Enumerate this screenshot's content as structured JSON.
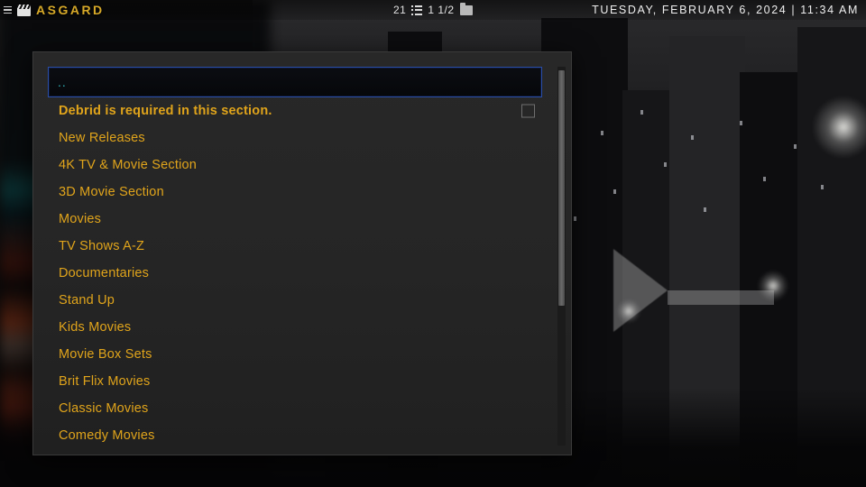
{
  "topbar": {
    "menu_icon": "hamburger-icon",
    "app_icon": "clapperboard-icon",
    "app_name": "ASGARD",
    "item_count": "21",
    "list_icon": "list-view-icon",
    "page_indicator": "1 1/2",
    "folder_icon": "folder-icon",
    "datetime": "TUESDAY, FEBRUARY 6, 2024 | 11:34 AM"
  },
  "dialog": {
    "checkbox_checked": false,
    "items": [
      {
        "label": "..",
        "selected": true,
        "bold": false,
        "checkbox": false
      },
      {
        "label": "Debrid is required in this section.",
        "selected": false,
        "bold": true,
        "checkbox": true
      },
      {
        "label": "New Releases",
        "selected": false,
        "bold": false,
        "checkbox": false
      },
      {
        "label": "4K TV & Movie Section",
        "selected": false,
        "bold": false,
        "checkbox": false
      },
      {
        "label": "3D Movie Section",
        "selected": false,
        "bold": false,
        "checkbox": false
      },
      {
        "label": "Movies",
        "selected": false,
        "bold": false,
        "checkbox": false
      },
      {
        "label": "TV Shows A-Z",
        "selected": false,
        "bold": false,
        "checkbox": false
      },
      {
        "label": "Documentaries",
        "selected": false,
        "bold": false,
        "checkbox": false
      },
      {
        "label": "Stand Up",
        "selected": false,
        "bold": false,
        "checkbox": false
      },
      {
        "label": "Kids Movies",
        "selected": false,
        "bold": false,
        "checkbox": false
      },
      {
        "label": "Movie Box Sets",
        "selected": false,
        "bold": false,
        "checkbox": false
      },
      {
        "label": "Brit Flix Movies",
        "selected": false,
        "bold": false,
        "checkbox": false
      },
      {
        "label": "Classic Movies",
        "selected": false,
        "bold": false,
        "checkbox": false
      },
      {
        "label": "Comedy Movies",
        "selected": false,
        "bold": false,
        "checkbox": false
      }
    ],
    "scrollbar": {
      "thumb_top_pct": 1,
      "thumb_height_pct": 62
    }
  },
  "colors": {
    "accent_gold": "#e0a41b",
    "selected_text": "#2fb7bd",
    "selected_border": "#2a4ea8",
    "dialog_bg": "#262626",
    "brand_gold": "#d7a928"
  }
}
